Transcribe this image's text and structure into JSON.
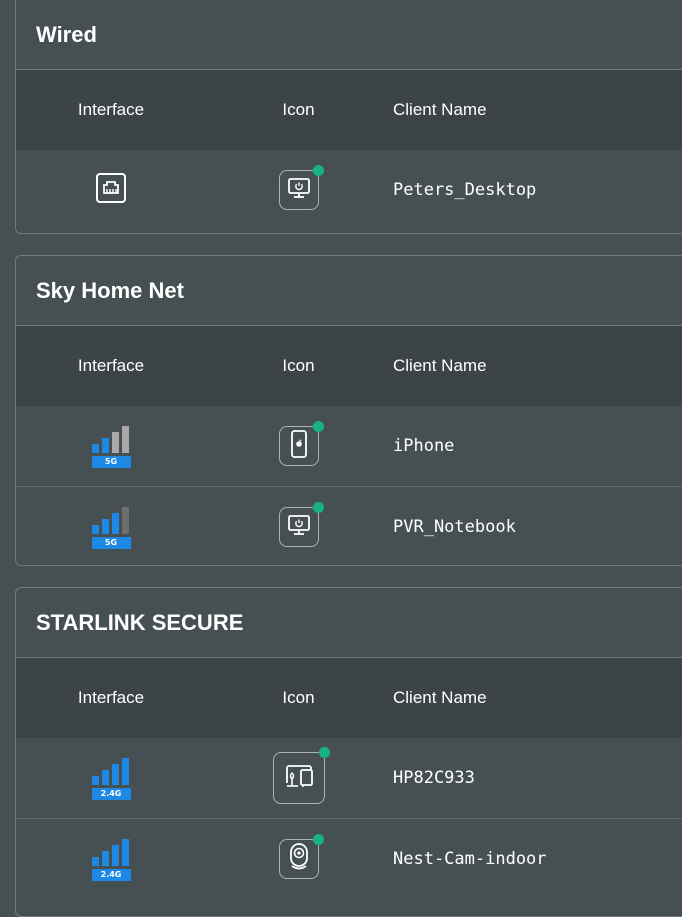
{
  "sections": [
    {
      "title": "Wired",
      "headers": {
        "interface": "Interface",
        "icon": "Icon",
        "client_name": "Client Name"
      },
      "rows": [
        {
          "interface": "ethernet-port-icon",
          "device_icon": "desktop-monitor-icon",
          "status": "online",
          "client_name": "Peters_Desktop"
        }
      ]
    },
    {
      "title": "Sky Home Net",
      "headers": {
        "interface": "Interface",
        "icon": "Icon",
        "client_name": "Client Name"
      },
      "rows": [
        {
          "interface": "wifi-signal-icon",
          "band": "5G",
          "signal_bars": 2,
          "device_icon": "smartphone-icon",
          "status": "online",
          "client_name": "iPhone"
        },
        {
          "interface": "wifi-signal-icon",
          "band": "5G",
          "signal_bars": 3,
          "device_icon": "desktop-monitor-icon",
          "status": "online",
          "client_name": "PVR_Notebook"
        }
      ]
    },
    {
      "title": "STARLINK SECURE",
      "headers": {
        "interface": "Interface",
        "icon": "Icon",
        "client_name": "Client Name"
      },
      "rows": [
        {
          "interface": "wifi-signal-icon",
          "band": "2.4G",
          "signal_bars": 4,
          "device_icon": "smart-devices-icon",
          "status": "online",
          "client_name": "HP82C933"
        },
        {
          "interface": "wifi-signal-icon",
          "band": "2.4G",
          "signal_bars": 4,
          "device_icon": "camera-icon",
          "status": "online",
          "client_name": "Nest-Cam-indoor"
        }
      ]
    }
  ],
  "colors": {
    "background": "#465053",
    "header_row": "#3c4448",
    "signal_active": "#1e88e5",
    "signal_inactive_light": "#a9a9a9",
    "signal_inactive_dark": "#6e6e6e",
    "online_dot": "#18b47f"
  }
}
